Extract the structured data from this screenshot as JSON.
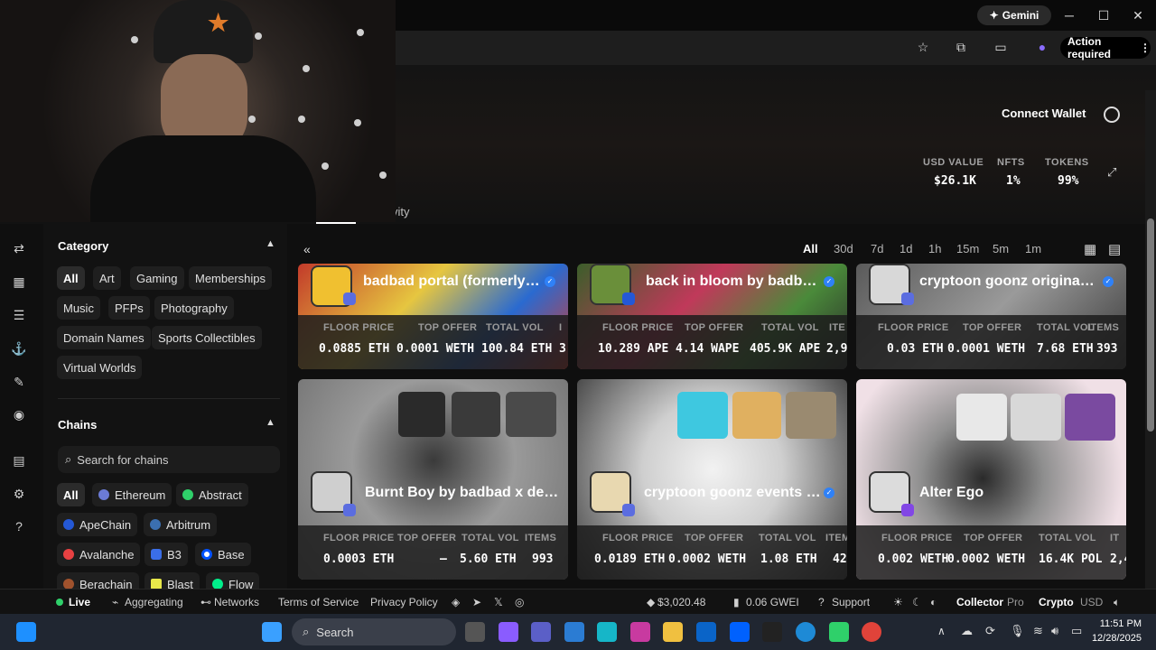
{
  "browser": {
    "gemini_label": "Gemini",
    "action_label": "Action required"
  },
  "header": {
    "connect_wallet": "Connect Wallet",
    "stats": [
      {
        "label": "USD VALUE",
        "value": "$26.1K"
      },
      {
        "label": "NFTS",
        "value": "1%"
      },
      {
        "label": "TOKENS",
        "value": "99%"
      }
    ],
    "tab_partial": "vity"
  },
  "sidebar": {
    "category_title": "Category",
    "categories": [
      "All",
      "Art",
      "Gaming",
      "Memberships",
      "Music",
      "PFPs",
      "Photography",
      "Domain Names",
      "Sports Collectibles",
      "Virtual Worlds"
    ],
    "chains_title": "Chains",
    "chain_search_placeholder": "Search for chains",
    "chains": [
      "All",
      "Ethereum",
      "Abstract",
      "ApeChain",
      "Arbitrum",
      "Avalanche",
      "B3",
      "Base",
      "Berachain",
      "Blast",
      "Flow"
    ]
  },
  "main": {
    "timeframes": [
      "All",
      "30d",
      "7d",
      "1d",
      "1h",
      "15m",
      "5m",
      "1m"
    ],
    "stat_labels": [
      "FLOOR PRICE",
      "TOP OFFER",
      "TOTAL VOL",
      "ITEMS"
    ],
    "cards": [
      {
        "name": "badbad portal (formerly ...",
        "floor": "0.0885 ETH",
        "offer": "0.0001 WETH",
        "vol": "100.84 ETH",
        "items": "3,",
        "items_label": "I"
      },
      {
        "name": "back in bloom by badbad...",
        "floor": "10.289 APE",
        "offer": "4.14 WAPE",
        "vol": "405.9K APE",
        "items": "2,97",
        "items_label": "ITE"
      },
      {
        "name": "cryptoon goonz originals...",
        "floor": "0.03 ETH",
        "offer": "0.0001 WETH",
        "vol": "7.68 ETH",
        "items": "393",
        "items_label": "ITEMS"
      },
      {
        "name": "Burnt Boy by badbad x dee...",
        "floor": "0.0003 ETH",
        "offer": "–",
        "vol": "5.60 ETH",
        "items": "993",
        "items_label": "ITEMS"
      },
      {
        "name": "cryptoon goonz events b...",
        "floor": "0.0189 ETH",
        "offer": "0.0002 WETH",
        "vol": "1.08 ETH",
        "items": "42",
        "items_label": "ITEM"
      },
      {
        "name": "Alter Ego",
        "floor": "0.002 WETH",
        "offer": "0.0002 WETH",
        "vol": "16.4K POL",
        "items": "2,4",
        "items_label": "IT"
      }
    ]
  },
  "statusbar": {
    "live": "Live",
    "aggregating": "Aggregating",
    "networks": "Networks",
    "terms": "Terms of Service",
    "privacy": "Privacy Policy",
    "eth_price": "$3,020.48",
    "gas": "0.06 GWEI",
    "support": "Support",
    "collector": "Collector",
    "pro": "Pro",
    "crypto": "Crypto",
    "usd": "USD"
  },
  "taskbar": {
    "search": "Search",
    "time": "11:51 PM",
    "date": "12/28/2025"
  }
}
